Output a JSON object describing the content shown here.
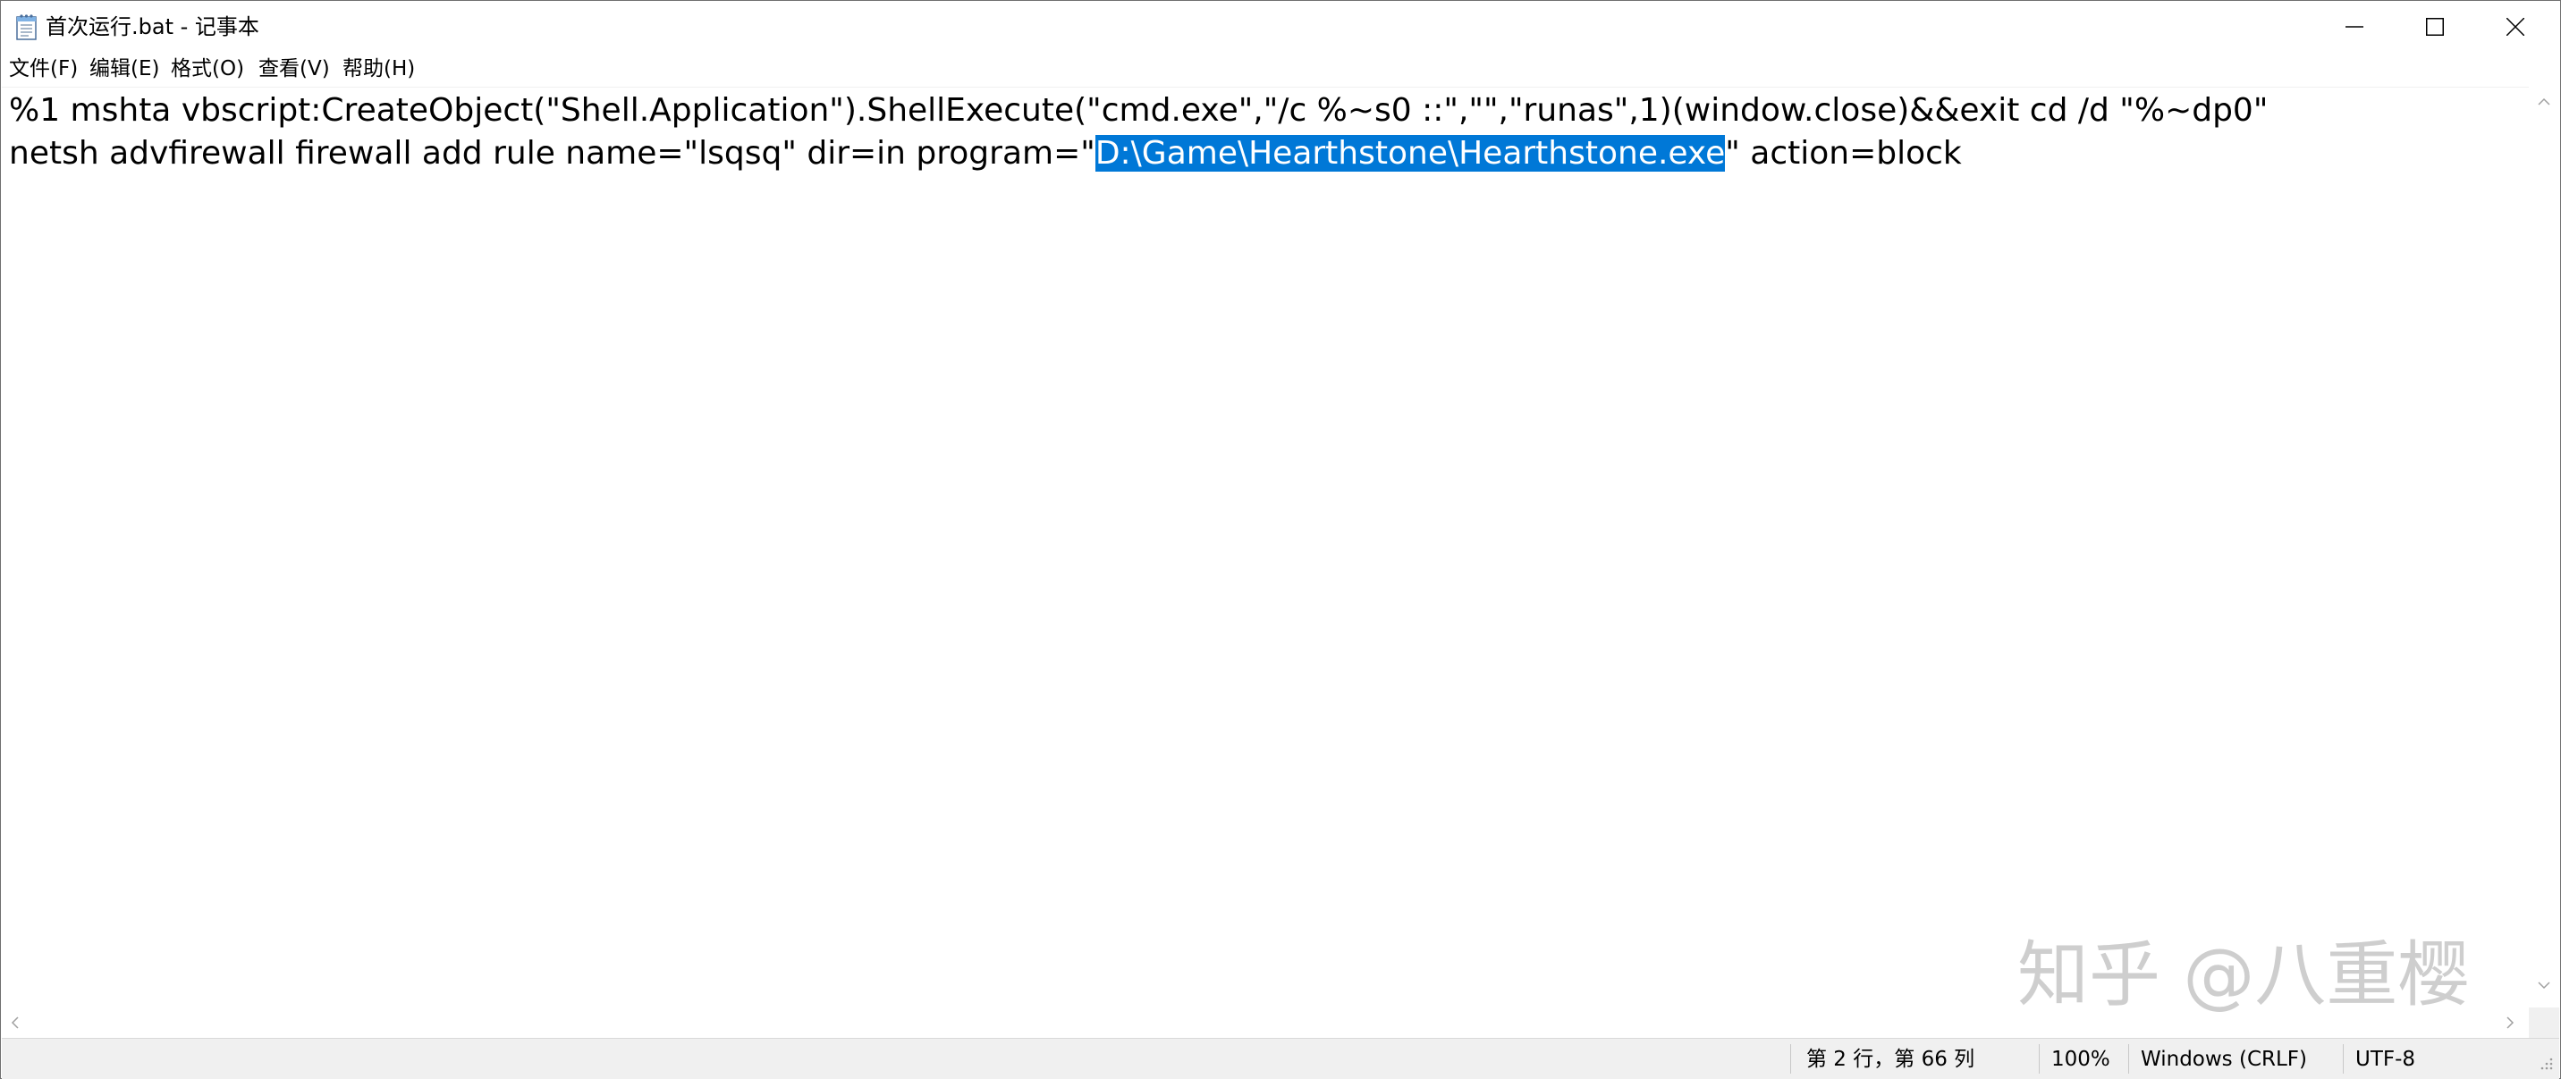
{
  "window": {
    "title": "首次运行.bat - 记事本"
  },
  "menu": {
    "items": [
      "文件(F)",
      "编辑(E)",
      "格式(O)",
      "查看(V)",
      "帮助(H)"
    ]
  },
  "editor": {
    "line1": "%1 mshta vbscript:CreateObject(\"Shell.Application\").ShellExecute(\"cmd.exe\",\"/c %~s0 ::\",\"\",\"runas\",1)(window.close)&&exit cd /d \"%~dp0\"",
    "line2_before": "netsh advfirewall firewall add rule name=\"lsqsq\" dir=in program=\"",
    "line2_selected": "D:\\Game\\Hearthstone\\Hearthstone.exe",
    "line2_after": "\" action=block"
  },
  "status": {
    "position": "第 2 行，第 66 列",
    "zoom": "100%",
    "line_ending": "Windows (CRLF)",
    "encoding": "UTF-8"
  },
  "watermark": "知乎 @八重樱",
  "icons": {
    "app": "notepad-icon",
    "minimize": "minimize-icon",
    "maximize": "maximize-icon",
    "close": "close-icon"
  },
  "colors": {
    "selection": "#0078d7",
    "statusbar_bg": "#f0f0f0"
  }
}
